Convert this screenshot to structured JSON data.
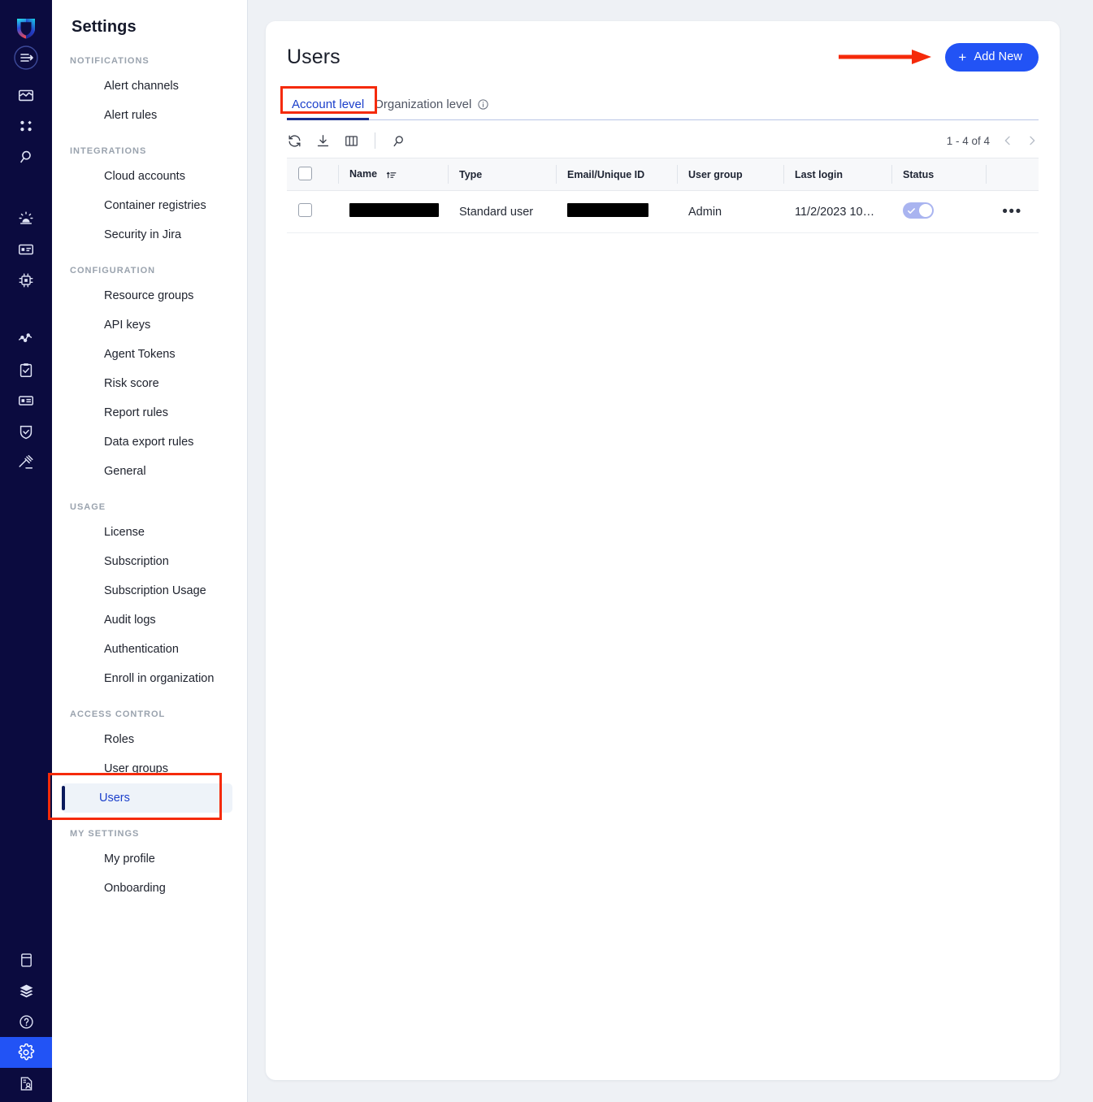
{
  "rail": {
    "logo_name": "app-shield-logo",
    "collapse_toggle": "sidebar-collapse-toggle",
    "items": [
      {
        "name": "dashboard-chart-icon"
      },
      {
        "name": "apps-grid-icon"
      },
      {
        "name": "search-icon"
      },
      {
        "name": "alerts-siren-icon"
      },
      {
        "name": "card-list-icon"
      },
      {
        "name": "chip-runtime-icon"
      },
      {
        "name": "activity-graph-icon"
      },
      {
        "name": "compliance-clipboard-icon"
      },
      {
        "name": "inventory-id-icon"
      },
      {
        "name": "shield-check-icon"
      },
      {
        "name": "gavel-policy-icon"
      }
    ],
    "bottom_items": [
      {
        "name": "docs-book-icon",
        "active": false
      },
      {
        "name": "layers-stack-icon",
        "active": false
      },
      {
        "name": "help-question-icon",
        "active": false
      },
      {
        "name": "settings-gear-icon",
        "active": true
      },
      {
        "name": "reports-user-icon",
        "active": false
      }
    ]
  },
  "sidebar": {
    "title": "Settings",
    "sections": [
      {
        "label": "NOTIFICATIONS",
        "items": [
          {
            "label": "Alert channels",
            "selected": false
          },
          {
            "label": "Alert rules",
            "selected": false
          }
        ]
      },
      {
        "label": "INTEGRATIONS",
        "items": [
          {
            "label": "Cloud accounts",
            "selected": false
          },
          {
            "label": "Container registries",
            "selected": false
          },
          {
            "label": "Security in Jira",
            "selected": false
          }
        ]
      },
      {
        "label": "CONFIGURATION",
        "items": [
          {
            "label": "Resource groups",
            "selected": false
          },
          {
            "label": "API keys",
            "selected": false
          },
          {
            "label": "Agent Tokens",
            "selected": false
          },
          {
            "label": "Risk score",
            "selected": false
          },
          {
            "label": "Report rules",
            "selected": false
          },
          {
            "label": "Data export rules",
            "selected": false
          },
          {
            "label": "General",
            "selected": false
          }
        ]
      },
      {
        "label": "USAGE",
        "items": [
          {
            "label": "License",
            "selected": false
          },
          {
            "label": "Subscription",
            "selected": false
          },
          {
            "label": "Subscription Usage",
            "selected": false
          },
          {
            "label": "Audit logs",
            "selected": false
          },
          {
            "label": "Authentication",
            "selected": false
          },
          {
            "label": "Enroll in organization",
            "selected": false
          }
        ]
      },
      {
        "label": "ACCESS CONTROL",
        "items": [
          {
            "label": "Roles",
            "selected": false
          },
          {
            "label": "User groups",
            "selected": false
          },
          {
            "label": "Users",
            "selected": true
          }
        ]
      },
      {
        "label": "MY SETTINGS",
        "items": [
          {
            "label": "My profile",
            "selected": false
          },
          {
            "label": "Onboarding",
            "selected": false
          }
        ]
      }
    ]
  },
  "main": {
    "title": "Users",
    "add_new_label": "Add New",
    "add_new_plus": "+",
    "tabs": [
      {
        "label": "Account level",
        "active": true,
        "has_info": false
      },
      {
        "label": "Organization level",
        "active": false,
        "has_info": true
      }
    ],
    "toolbar": {
      "refresh": "refresh-icon",
      "download": "download-icon",
      "columns": "columns-icon",
      "search": "search-icon"
    },
    "pagination": {
      "range_text": "1 - 4 of 4",
      "prev": "chevron-left-icon",
      "next": "chevron-right-icon"
    },
    "table": {
      "columns": [
        {
          "label": "",
          "key": "checkbox"
        },
        {
          "label": "Name",
          "key": "name",
          "sorted": true
        },
        {
          "label": "Type",
          "key": "type"
        },
        {
          "label": "Email/Unique ID",
          "key": "email"
        },
        {
          "label": "User group",
          "key": "group"
        },
        {
          "label": "Last login",
          "key": "last_login"
        },
        {
          "label": "Status",
          "key": "status"
        },
        {
          "label": "",
          "key": "actions"
        }
      ],
      "rows": [
        {
          "name": "",
          "name_redacted": true,
          "type": "Standard user",
          "email": "",
          "email_redacted": true,
          "group": "Admin",
          "last_login": "11/2/2023 10…",
          "status_enabled": true,
          "actions": "•••"
        }
      ]
    }
  },
  "annotations": {
    "arrow_color": "#f52a0a",
    "highlight_box_color": "#f52a0a",
    "arrow_target": "add-new-button",
    "boxes": [
      "account-level-tab",
      "sidebar-item-users"
    ]
  },
  "colors": {
    "brand_blue": "#2253f5",
    "rail_navy": "#0b0b3f",
    "page_bg": "#eef1f5",
    "toggle_on": "#a9b4f0"
  }
}
